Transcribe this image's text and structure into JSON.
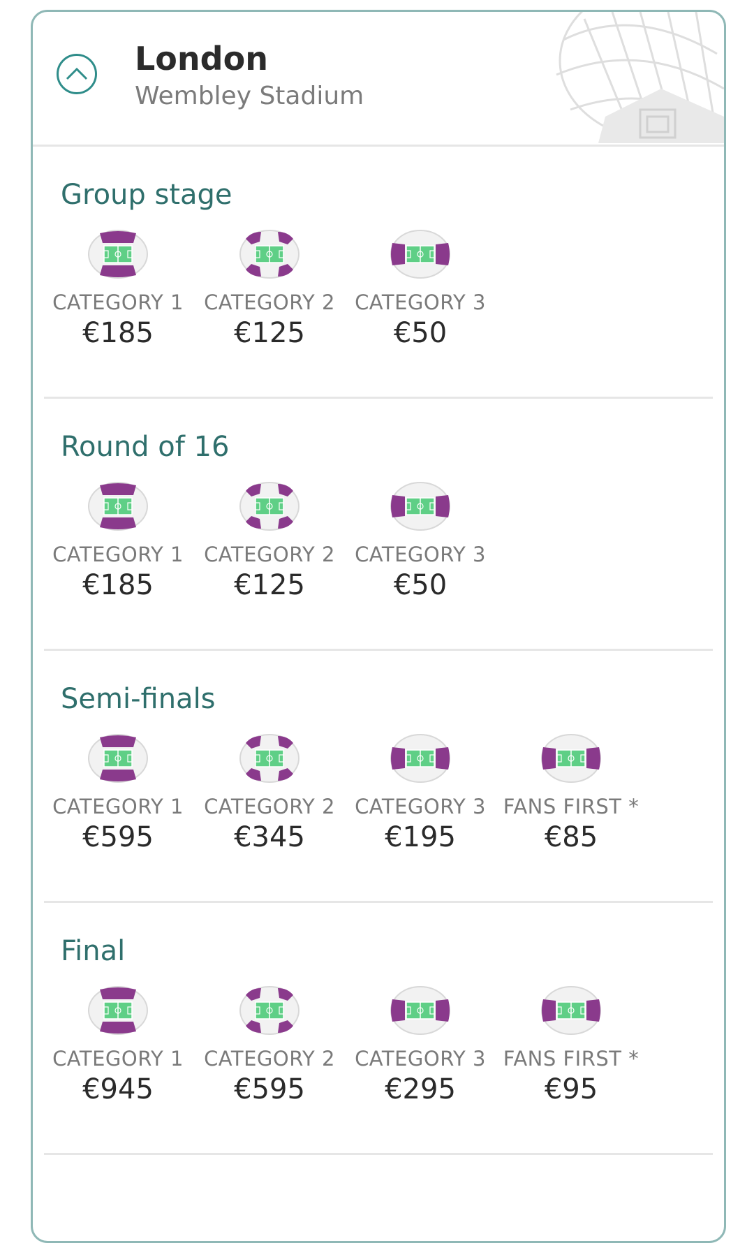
{
  "header": {
    "city": "London",
    "venue": "Wembley Stadium"
  },
  "sections": [
    {
      "title": "Group stage",
      "tiers": [
        {
          "label": "CATEGORY 1",
          "price": "€185",
          "icon": "stadium-seat-category-1-icon"
        },
        {
          "label": "CATEGORY 2",
          "price": "€125",
          "icon": "stadium-seat-category-2-icon"
        },
        {
          "label": "CATEGORY 3",
          "price": "€50",
          "icon": "stadium-seat-category-3-icon"
        }
      ]
    },
    {
      "title": "Round of 16",
      "tiers": [
        {
          "label": "CATEGORY 1",
          "price": "€185",
          "icon": "stadium-seat-category-1-icon"
        },
        {
          "label": "CATEGORY 2",
          "price": "€125",
          "icon": "stadium-seat-category-2-icon"
        },
        {
          "label": "CATEGORY 3",
          "price": "€50",
          "icon": "stadium-seat-category-3-icon"
        }
      ]
    },
    {
      "title": "Semi-finals",
      "tiers": [
        {
          "label": "CATEGORY 1",
          "price": "€595",
          "icon": "stadium-seat-category-1-icon"
        },
        {
          "label": "CATEGORY 2",
          "price": "€345",
          "icon": "stadium-seat-category-2-icon"
        },
        {
          "label": "CATEGORY 3",
          "price": "€195",
          "icon": "stadium-seat-category-3-icon"
        },
        {
          "label": "FANS FIRST *",
          "price": "€85",
          "icon": "stadium-seat-fans-first-icon"
        }
      ]
    },
    {
      "title": "Final",
      "tiers": [
        {
          "label": "CATEGORY 1",
          "price": "€945",
          "icon": "stadium-seat-category-1-icon"
        },
        {
          "label": "CATEGORY 2",
          "price": "€595",
          "icon": "stadium-seat-category-2-icon"
        },
        {
          "label": "CATEGORY 3",
          "price": "€295",
          "icon": "stadium-seat-category-3-icon"
        },
        {
          "label": "FANS FIRST *",
          "price": "€95",
          "icon": "stadium-seat-fans-first-icon"
        }
      ]
    }
  ],
  "colors": {
    "accent": "#2f8d8a",
    "title": "#2f6f6c",
    "seat_purple": "#8a3a8c",
    "pitch_green": "#5fcf86"
  }
}
